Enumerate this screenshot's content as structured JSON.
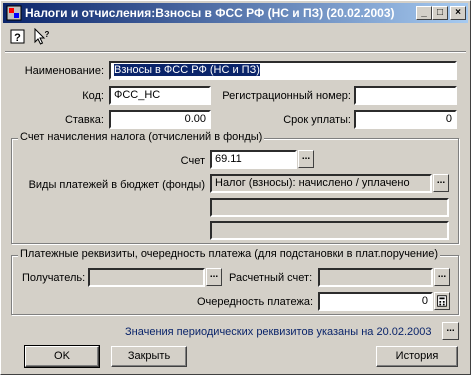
{
  "window": {
    "title": "Налоги и отчисления:Взносы в ФСС РФ (НС и ПЗ) (20.02.2003)",
    "minimize_glyph": "_",
    "maximize_glyph": "□",
    "close_glyph": "×"
  },
  "toolbar": {
    "help_icon": "help-icon",
    "whats_this_icon": "whats-this-icon"
  },
  "form": {
    "name_label": "Наименование:",
    "name_value": "Взносы в ФСС РФ (НС и ПЗ)",
    "code_label": "Код:",
    "code_value": "ФСС_НС",
    "regnum_label": "Регистрационный номер:",
    "regnum_value": "",
    "rate_label": "Ставка:",
    "rate_value": "0.00",
    "term_label": "Срок уплаты:",
    "term_value": "0"
  },
  "account_group": {
    "title": "Счет начисления налога (отчислений в фонды)",
    "account_label": "Счет",
    "account_value": "69.11",
    "payment_types_label": "Виды платежей в бюджет (фонды)",
    "payment_types_value": "Налог (взносы): начислено / уплачено",
    "extra1_value": "",
    "extra2_value": "",
    "ellipsis": "..."
  },
  "payment_group": {
    "title": "Платежные реквизиты, очередность платежа (для подстановки в плат.поручение)",
    "recipient_label": "Получатель:",
    "recipient_value": "",
    "account_label": "Расчетный счет:",
    "account_value": "",
    "priority_label": "Очередность платежа:",
    "priority_value": "0"
  },
  "footer": {
    "periodic_info": "Значения периодических реквизитов указаны на 20.02.2003",
    "ok_label": "OK",
    "close_label": "Закрыть",
    "history_label": "История"
  }
}
